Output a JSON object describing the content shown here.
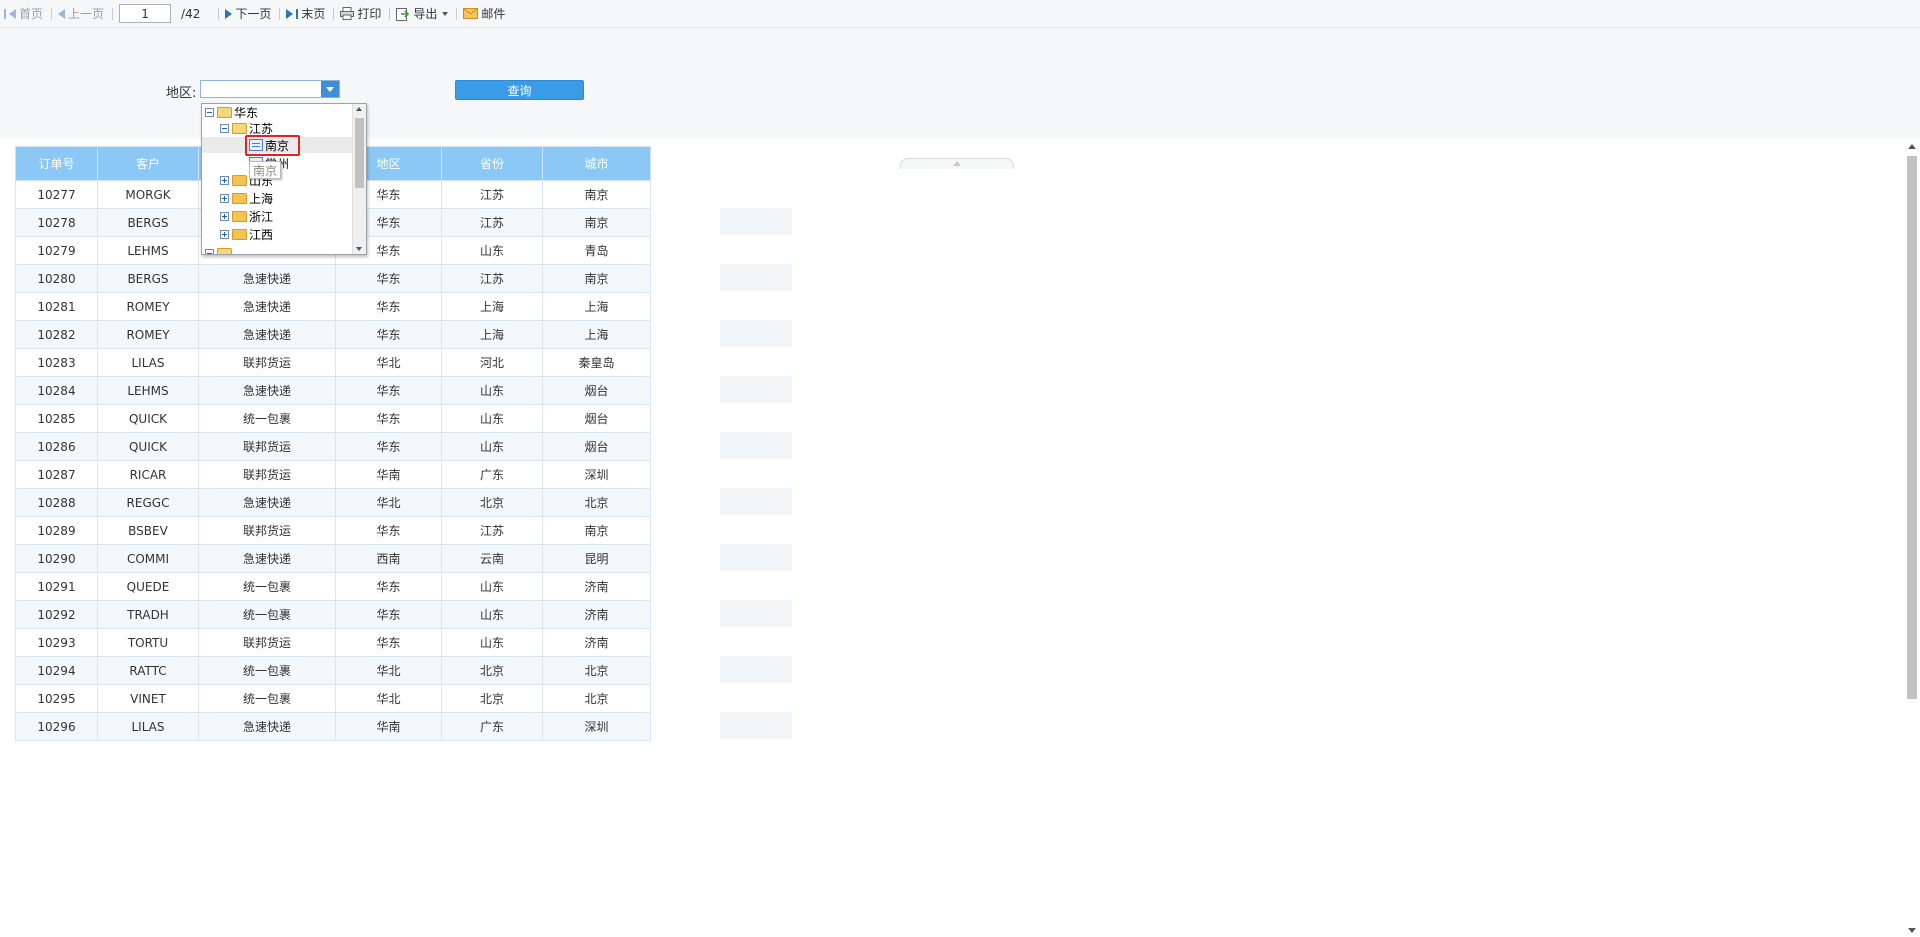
{
  "toolbar": {
    "first_page": "首页",
    "prev_page": "上一页",
    "page_value": "1",
    "page_total": "/42",
    "next_page": "下一页",
    "last_page": "末页",
    "print": "打印",
    "export": "导出",
    "mail": "邮件"
  },
  "query": {
    "region_label": "地区:",
    "region_value": "",
    "query_button": "查询"
  },
  "tree": {
    "node_huadong": "华东",
    "node_jiangsu": "江苏",
    "node_nanjing": "南京",
    "node_changzhou": "常州",
    "node_shandong": "山东",
    "tooltip": "南京",
    "node_shanghai": "上海",
    "node_zhejiang": "浙江",
    "node_jiangxi": "江西"
  },
  "table": {
    "headers": [
      "订单号",
      "客户",
      "",
      "地区",
      "省份",
      "城市"
    ],
    "rows": [
      [
        "10277",
        "MORGK",
        "",
        "华东",
        "江苏",
        "南京"
      ],
      [
        "10278",
        "BERGS",
        "",
        "华东",
        "江苏",
        "南京"
      ],
      [
        "10279",
        "LEHMS",
        "",
        "华东",
        "山东",
        "青岛"
      ],
      [
        "10280",
        "BERGS",
        "急速快递",
        "华东",
        "江苏",
        "南京"
      ],
      [
        "10281",
        "ROMEY",
        "急速快递",
        "华东",
        "上海",
        "上海"
      ],
      [
        "10282",
        "ROMEY",
        "急速快递",
        "华东",
        "上海",
        "上海"
      ],
      [
        "10283",
        "LILAS",
        "联邦货运",
        "华北",
        "河北",
        "秦皇岛"
      ],
      [
        "10284",
        "LEHMS",
        "急速快递",
        "华东",
        "山东",
        "烟台"
      ],
      [
        "10285",
        "QUICK",
        "统一包裹",
        "华东",
        "山东",
        "烟台"
      ],
      [
        "10286",
        "QUICK",
        "联邦货运",
        "华东",
        "山东",
        "烟台"
      ],
      [
        "10287",
        "RICAR",
        "联邦货运",
        "华南",
        "广东",
        "深圳"
      ],
      [
        "10288",
        "REGGC",
        "急速快递",
        "华北",
        "北京",
        "北京"
      ],
      [
        "10289",
        "BSBEV",
        "联邦货运",
        "华东",
        "江苏",
        "南京"
      ],
      [
        "10290",
        "COMMI",
        "急速快递",
        "西南",
        "云南",
        "昆明"
      ],
      [
        "10291",
        "QUEDE",
        "统一包裹",
        "华东",
        "山东",
        "济南"
      ],
      [
        "10292",
        "TRADH",
        "统一包裹",
        "华东",
        "山东",
        "济南"
      ],
      [
        "10293",
        "TORTU",
        "联邦货运",
        "华东",
        "山东",
        "济南"
      ],
      [
        "10294",
        "RATTC",
        "统一包裹",
        "华北",
        "北京",
        "北京"
      ],
      [
        "10295",
        "VINET",
        "统一包裹",
        "华北",
        "北京",
        "北京"
      ],
      [
        "10296",
        "LILAS",
        "急速快递",
        "华南",
        "广东",
        "深圳"
      ]
    ]
  }
}
